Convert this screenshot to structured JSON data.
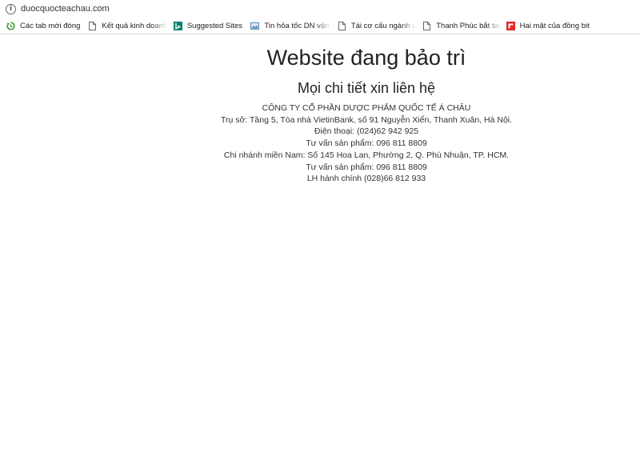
{
  "browser": {
    "url": "duocquocteachau.com"
  },
  "bookmarks": [
    {
      "label": "Các tab mới đóng",
      "icon": "recent-tabs-icon"
    },
    {
      "label": "Kết quả kinh doanh V",
      "icon": "page-icon"
    },
    {
      "label": "Suggested Sites",
      "icon": "bing-icon"
    },
    {
      "label": "Tin hỏa tốc DN vận tả",
      "icon": "image-icon"
    },
    {
      "label": "Tái cơ cấu ngành tàu",
      "icon": "page-icon"
    },
    {
      "label": "Thanh Phúc bắt tay đ",
      "icon": "page-icon"
    },
    {
      "label": "Hai mặt của đồng bit",
      "icon": "flipboard-icon"
    }
  ],
  "page": {
    "title": "Website đang bảo trì",
    "subtitle": "Mọi chi tiết xin liên hệ",
    "lines": [
      "CÔNG TY CỔ PHẦN DƯỢC PHẨM QUỐC TẾ Á CHÂU",
      "Trụ sở: Tầng 5, Tòa nhà VietinBank, số 91 Nguyễn Xiển, Thanh Xuân, Hà Nội.",
      "Điện thoại: (024)62 942 925",
      "Tư vấn sản phẩm: 096 811 8809",
      "Chi nhánh miền Nam: Số 145 Hoa Lan, Phường 2, Q. Phú Nhuận, TP. HCM.",
      "Tư vấn sản phẩm: 096 811 8809",
      "LH hành chính (028)66 812 933"
    ]
  },
  "colors": {
    "bing": "#008373",
    "flipboard": "#e12828",
    "recent": "#3a9a3a"
  }
}
